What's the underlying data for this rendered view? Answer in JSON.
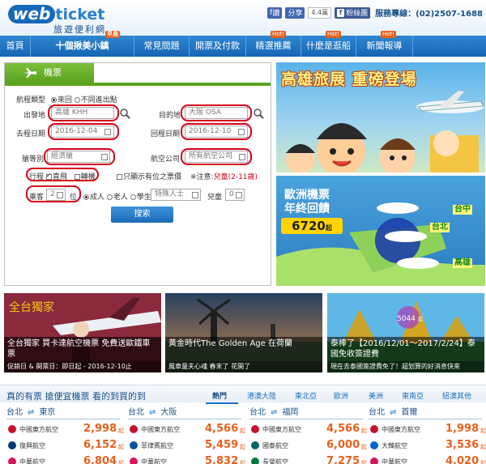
{
  "header": {
    "logo_web": "web",
    "logo_ticket": "ticket",
    "logo_sub": "旅遊便利網",
    "fb_like": "讚",
    "fb_share": "分享",
    "share_count": "4.4萬",
    "fb_fan": "粉絲團",
    "phone": "服務專線：(02)2507-1688"
  },
  "nav": {
    "items": [
      {
        "label": "首頁"
      },
      {
        "label": "十個揪美小鎮",
        "badge": "早鳥"
      },
      {
        "label": "常見問題"
      },
      {
        "label": "開票及付款"
      },
      {
        "label": "精選推薦",
        "badge": "Hot!"
      },
      {
        "label": "什麼是逛船",
        "badge": "Hot!"
      },
      {
        "label": "新聞報導",
        "badge": "Hot!"
      }
    ]
  },
  "booking": {
    "tab_label": "機票",
    "trip_type_label": "航程類型",
    "trip_round": "來回",
    "trip_openjaw": "不同進出點",
    "depart_label": "出發地",
    "depart_value": "高雄 KHH",
    "dest_label": "目的地",
    "dest_value": "大阪 OSA",
    "go_date_label": "去程日期",
    "go_date_value": "2016-12-04",
    "return_date_label": "回程日期",
    "return_date_value": "2016-12-10",
    "cabin_label": "艙等別",
    "cabin_value": "經濟艙",
    "airline_label": "航空公司",
    "airline_value": "所有航空公司",
    "route_label": "行程",
    "route_direct": "直飛",
    "route_transfer": "轉機",
    "seats_only": "只顯示有位之票價",
    "note": "※注意:",
    "note_child": "兒童(2-11歲)",
    "pax_label": "乘客",
    "pax_value": "2",
    "pax_unit": "位",
    "pax_adult": "成人",
    "pax_senior": "老人",
    "pax_student": "學生",
    "pax_special": "特殊人士",
    "pax_child": "兒童",
    "pax_child_value": "0",
    "search": "搜索"
  },
  "banners": {
    "b1_title": "高雄旅展 重磅登場",
    "b2_title_1": "歐洲機票",
    "b2_title_2": "年終回饋",
    "b2_price": "6720",
    "b2_price_unit": "起",
    "b2_cities": [
      "台中",
      "台北",
      "高雄"
    ]
  },
  "cards": [
    {
      "caption": "全台獨家 買卡達航空機票 免費送歐鐵車票",
      "sub": "促銷日 & 開票日：即日起 - 2016-12-10止",
      "logo": "全台獨家"
    },
    {
      "caption": "黃金時代The Golden Age 在荷蘭",
      "sub": "風車童夫心魂 春末了 花開了"
    },
    {
      "caption": "泰棒了【2016/12/01～2017/2/24】泰國免收簽證費",
      "sub": "現在去泰國簽證費免了！超划算的好消息快來",
      "price": "5044",
      "price_unit": "起"
    }
  ],
  "bottom": {
    "title": "真的有票 搶便宜機票 看的到買的到",
    "tabs": [
      "熱門",
      "港澳大陸",
      "東北亞",
      "歐洲",
      "美洲",
      "東南亞",
      "紐澳其他"
    ],
    "routes": [
      {
        "from": "台北",
        "to": "東京",
        "fares": [
          {
            "airline": "中國東方航空",
            "price": "2,998",
            "color": "#c8102e"
          },
          {
            "airline": "復興航空",
            "price": "6,152",
            "color": "#003a78"
          },
          {
            "airline": "中華航空",
            "price": "6,804",
            "color": "#d4145a"
          }
        ]
      },
      {
        "from": "台北",
        "to": "大阪",
        "fares": [
          {
            "airline": "中國東方航空",
            "price": "4,566",
            "color": "#c8102e"
          },
          {
            "airline": "菲律賓航空",
            "price": "5,459",
            "color": "#00539b"
          },
          {
            "airline": "中華航空",
            "price": "5,832",
            "color": "#d4145a"
          }
        ]
      },
      {
        "from": "台北",
        "to": "福岡",
        "fares": [
          {
            "airline": "中國東方航空",
            "price": "4,566",
            "color": "#c8102e"
          },
          {
            "airline": "國泰航空",
            "price": "6,000",
            "color": "#006564"
          },
          {
            "airline": "長榮航空",
            "price": "7,275",
            "color": "#007a3d"
          }
        ]
      },
      {
        "from": "台北",
        "to": "首爾",
        "fares": [
          {
            "airline": "中國東方航空",
            "price": "1,998",
            "color": "#c8102e"
          },
          {
            "airline": "大韓航空",
            "price": "3,536",
            "color": "#0064d2"
          },
          {
            "airline": "中華航空",
            "price": "4,020",
            "color": "#d4145a"
          }
        ]
      }
    ],
    "price_unit": "起"
  }
}
